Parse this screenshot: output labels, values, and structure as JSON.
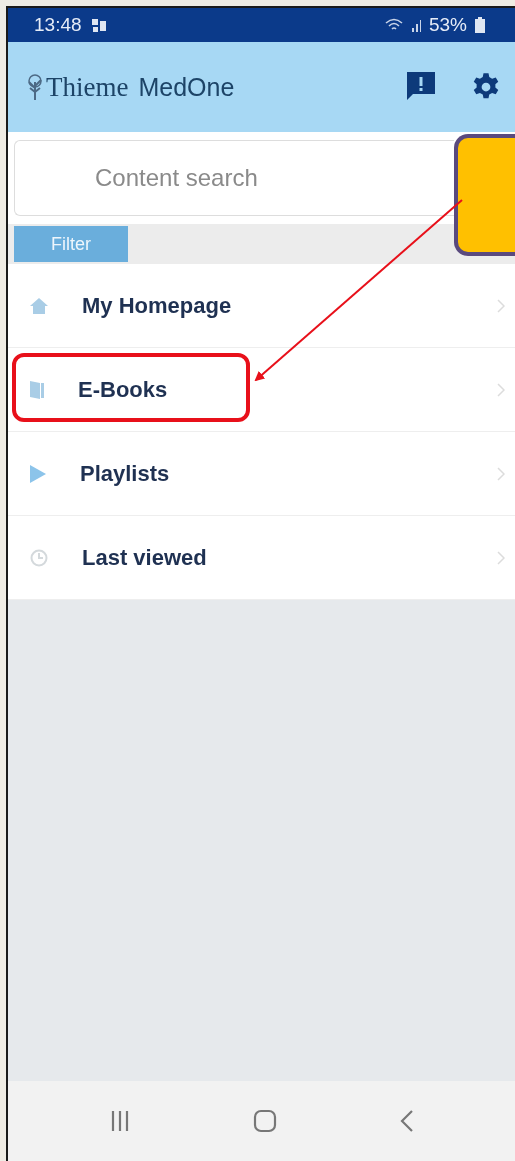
{
  "status_bar": {
    "time": "13:48",
    "battery": "53%"
  },
  "app_bar": {
    "logo_word_1": "Thieme",
    "logo_word_2": "MedOne"
  },
  "search": {
    "placeholder": "Content search"
  },
  "filter": {
    "label": "Filter"
  },
  "menu": [
    {
      "kind": "home",
      "label": "My Homepage",
      "annotated": false
    },
    {
      "kind": "book",
      "label": "E-Books",
      "annotated": true
    },
    {
      "kind": "play",
      "label": "Playlists",
      "annotated": false
    },
    {
      "kind": "clock",
      "label": "Last viewed",
      "annotated": false
    }
  ]
}
